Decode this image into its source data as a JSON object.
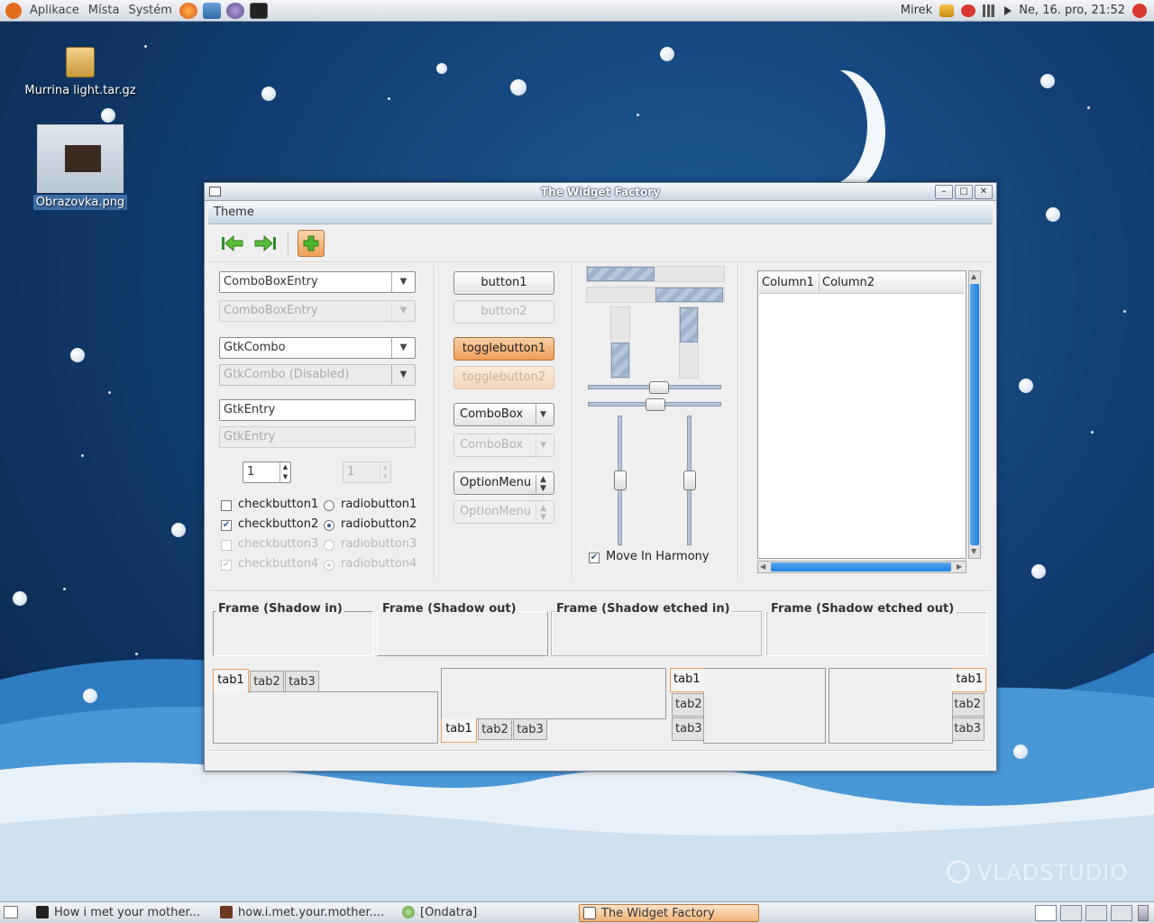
{
  "top_panel": {
    "menus": [
      "Aplikace",
      "Místa",
      "Systém"
    ],
    "user": "Mirek",
    "clock": "Ne, 16. pro, 21:52"
  },
  "desktop": {
    "icons": [
      {
        "label": "Murrina light.tar.gz",
        "icon": "archive-icon"
      },
      {
        "label": "Obrazovka.png",
        "icon": "image-thumbnail-icon"
      }
    ],
    "watermark": "VLADSTUDIO"
  },
  "window": {
    "title": "The Widget Factory",
    "menu": {
      "theme": "Theme"
    },
    "toolbar": {
      "back_icon": "arrow-left-icon",
      "forward_icon": "arrow-right-icon",
      "add_icon": "plus-icon"
    },
    "entries": {
      "comboentry": "ComboBoxEntry",
      "comboentry_disabled": "ComboBoxEntry",
      "gtkcombo": "GtkCombo",
      "gtkcombo_disabled": "GtkCombo (Disabled)",
      "gtkentry": "GtkEntry",
      "gtkentry_disabled": "GtkEntry",
      "spin": "1",
      "spin_disabled": "1"
    },
    "checks": [
      {
        "label": "checkbutton1",
        "checked": false
      },
      {
        "label": "checkbutton2",
        "checked": true
      },
      {
        "label": "checkbutton3",
        "checked": false
      },
      {
        "label": "checkbutton4",
        "checked": true
      }
    ],
    "radios": [
      "radiobutton1",
      "radiobutton2",
      "radiobutton3",
      "radiobutton4"
    ],
    "buttons": {
      "button1": "button1",
      "button2": "button2",
      "toggle1": "togglebutton1",
      "toggle2": "togglebutton2",
      "combobox": "ComboBox",
      "combobox_disabled": "ComboBox",
      "optionmenu": "OptionMenu",
      "optionmenu_disabled": "OptionMenu"
    },
    "move_in_harmony": "Move In Harmony",
    "tree": {
      "columns": [
        "Column1",
        "Column2"
      ]
    },
    "frames": [
      "Frame (Shadow in)",
      "Frame (Shadow out)",
      "Frame (Shadow etched in)",
      "Frame (Shadow etched out)"
    ],
    "tabs": [
      "tab1",
      "tab2",
      "tab3"
    ]
  },
  "taskbar": {
    "tasks": [
      "How i met your mother...",
      "how.i.met.your.mother....",
      "[Ondatra]",
      "The Widget Factory"
    ]
  },
  "colors": {
    "accent": "#ee9e58",
    "selection": "#1f7fe0",
    "panel": "#d4dae2"
  }
}
